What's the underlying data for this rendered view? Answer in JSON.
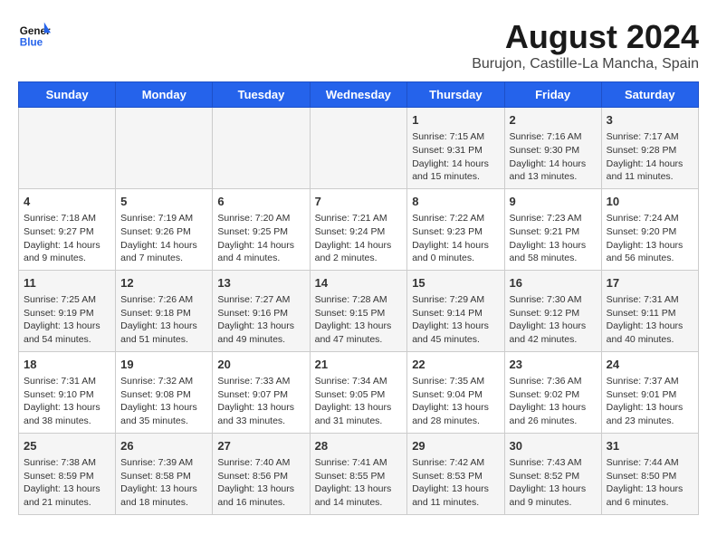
{
  "header": {
    "logo_line1": "General",
    "logo_line2": "Blue",
    "title": "August 2024",
    "subtitle": "Burujon, Castille-La Mancha, Spain"
  },
  "days_of_week": [
    "Sunday",
    "Monday",
    "Tuesday",
    "Wednesday",
    "Thursday",
    "Friday",
    "Saturday"
  ],
  "weeks": [
    [
      {
        "day": "",
        "content": ""
      },
      {
        "day": "",
        "content": ""
      },
      {
        "day": "",
        "content": ""
      },
      {
        "day": "",
        "content": ""
      },
      {
        "day": "1",
        "content": "Sunrise: 7:15 AM\nSunset: 9:31 PM\nDaylight: 14 hours and 15 minutes."
      },
      {
        "day": "2",
        "content": "Sunrise: 7:16 AM\nSunset: 9:30 PM\nDaylight: 14 hours and 13 minutes."
      },
      {
        "day": "3",
        "content": "Sunrise: 7:17 AM\nSunset: 9:28 PM\nDaylight: 14 hours and 11 minutes."
      }
    ],
    [
      {
        "day": "4",
        "content": "Sunrise: 7:18 AM\nSunset: 9:27 PM\nDaylight: 14 hours and 9 minutes."
      },
      {
        "day": "5",
        "content": "Sunrise: 7:19 AM\nSunset: 9:26 PM\nDaylight: 14 hours and 7 minutes."
      },
      {
        "day": "6",
        "content": "Sunrise: 7:20 AM\nSunset: 9:25 PM\nDaylight: 14 hours and 4 minutes."
      },
      {
        "day": "7",
        "content": "Sunrise: 7:21 AM\nSunset: 9:24 PM\nDaylight: 14 hours and 2 minutes."
      },
      {
        "day": "8",
        "content": "Sunrise: 7:22 AM\nSunset: 9:23 PM\nDaylight: 14 hours and 0 minutes."
      },
      {
        "day": "9",
        "content": "Sunrise: 7:23 AM\nSunset: 9:21 PM\nDaylight: 13 hours and 58 minutes."
      },
      {
        "day": "10",
        "content": "Sunrise: 7:24 AM\nSunset: 9:20 PM\nDaylight: 13 hours and 56 minutes."
      }
    ],
    [
      {
        "day": "11",
        "content": "Sunrise: 7:25 AM\nSunset: 9:19 PM\nDaylight: 13 hours and 54 minutes."
      },
      {
        "day": "12",
        "content": "Sunrise: 7:26 AM\nSunset: 9:18 PM\nDaylight: 13 hours and 51 minutes."
      },
      {
        "day": "13",
        "content": "Sunrise: 7:27 AM\nSunset: 9:16 PM\nDaylight: 13 hours and 49 minutes."
      },
      {
        "day": "14",
        "content": "Sunrise: 7:28 AM\nSunset: 9:15 PM\nDaylight: 13 hours and 47 minutes."
      },
      {
        "day": "15",
        "content": "Sunrise: 7:29 AM\nSunset: 9:14 PM\nDaylight: 13 hours and 45 minutes."
      },
      {
        "day": "16",
        "content": "Sunrise: 7:30 AM\nSunset: 9:12 PM\nDaylight: 13 hours and 42 minutes."
      },
      {
        "day": "17",
        "content": "Sunrise: 7:31 AM\nSunset: 9:11 PM\nDaylight: 13 hours and 40 minutes."
      }
    ],
    [
      {
        "day": "18",
        "content": "Sunrise: 7:31 AM\nSunset: 9:10 PM\nDaylight: 13 hours and 38 minutes."
      },
      {
        "day": "19",
        "content": "Sunrise: 7:32 AM\nSunset: 9:08 PM\nDaylight: 13 hours and 35 minutes."
      },
      {
        "day": "20",
        "content": "Sunrise: 7:33 AM\nSunset: 9:07 PM\nDaylight: 13 hours and 33 minutes."
      },
      {
        "day": "21",
        "content": "Sunrise: 7:34 AM\nSunset: 9:05 PM\nDaylight: 13 hours and 31 minutes."
      },
      {
        "day": "22",
        "content": "Sunrise: 7:35 AM\nSunset: 9:04 PM\nDaylight: 13 hours and 28 minutes."
      },
      {
        "day": "23",
        "content": "Sunrise: 7:36 AM\nSunset: 9:02 PM\nDaylight: 13 hours and 26 minutes."
      },
      {
        "day": "24",
        "content": "Sunrise: 7:37 AM\nSunset: 9:01 PM\nDaylight: 13 hours and 23 minutes."
      }
    ],
    [
      {
        "day": "25",
        "content": "Sunrise: 7:38 AM\nSunset: 8:59 PM\nDaylight: 13 hours and 21 minutes."
      },
      {
        "day": "26",
        "content": "Sunrise: 7:39 AM\nSunset: 8:58 PM\nDaylight: 13 hours and 18 minutes."
      },
      {
        "day": "27",
        "content": "Sunrise: 7:40 AM\nSunset: 8:56 PM\nDaylight: 13 hours and 16 minutes."
      },
      {
        "day": "28",
        "content": "Sunrise: 7:41 AM\nSunset: 8:55 PM\nDaylight: 13 hours and 14 minutes."
      },
      {
        "day": "29",
        "content": "Sunrise: 7:42 AM\nSunset: 8:53 PM\nDaylight: 13 hours and 11 minutes."
      },
      {
        "day": "30",
        "content": "Sunrise: 7:43 AM\nSunset: 8:52 PM\nDaylight: 13 hours and 9 minutes."
      },
      {
        "day": "31",
        "content": "Sunrise: 7:44 AM\nSunset: 8:50 PM\nDaylight: 13 hours and 6 minutes."
      }
    ]
  ]
}
